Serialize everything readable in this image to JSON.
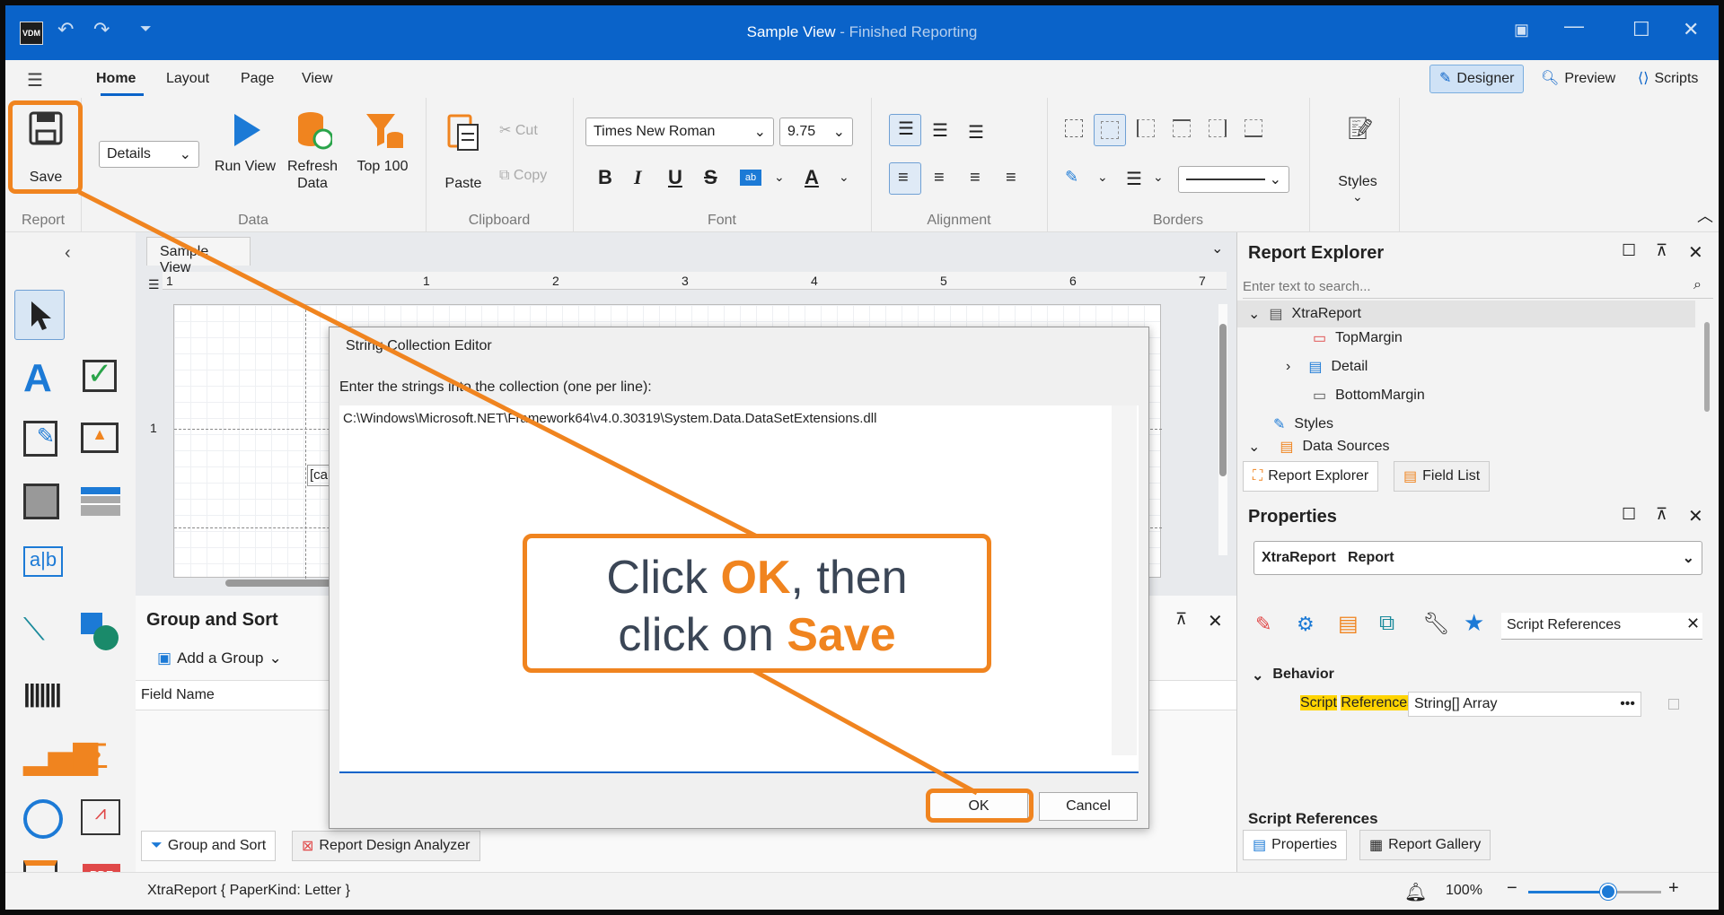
{
  "app": {
    "title": "Sample View",
    "title_suffix": "- Finished Reporting",
    "logo": "VDM"
  },
  "tabs": [
    "Home",
    "Layout",
    "Page",
    "View"
  ],
  "right_tabs": {
    "designer": "Designer",
    "preview": "Preview",
    "scripts": "Scripts"
  },
  "ribbon": {
    "save": "Save",
    "group_report": "Report",
    "details_combo": "Details",
    "run_view": "Run View",
    "refresh_data": "Refresh Data",
    "top100": "Top 100",
    "group_data": "Data",
    "paste": "Paste",
    "cut": "Cut",
    "copy": "Copy",
    "group_clipboard": "Clipboard",
    "font_name": "Times New Roman",
    "font_size": "9.75",
    "group_font": "Font",
    "group_alignment": "Alignment",
    "group_borders": "Borders",
    "styles": "Styles"
  },
  "document": {
    "tab": "Sample View",
    "ruler": [
      "1",
      "1",
      "2",
      "3",
      "4",
      "5",
      "6",
      "7"
    ],
    "side_number": "1",
    "field_partial": "[ca"
  },
  "group_sort": {
    "title": "Group and Sort",
    "add_group": "Add a Group",
    "column_field_name": "Field Name",
    "tab_group_sort": "Group and Sort",
    "tab_analyzer": "Report Design Analyzer"
  },
  "report_explorer": {
    "title": "Report Explorer",
    "search_placeholder": "Enter text to search...",
    "items": [
      "XtraReport",
      "TopMargin",
      "Detail",
      "BottomMargin",
      "Styles",
      "Data Sources"
    ],
    "tab_explorer": "Report Explorer",
    "tab_fieldlist": "Field List"
  },
  "properties": {
    "title": "Properties",
    "object_combo_name": "XtraReport",
    "object_combo_type": "Report",
    "search_value": "Script References",
    "category": "Behavior",
    "prop_name_1": "Script",
    "prop_name_2": "References",
    "prop_value": "String[] Array",
    "description_title": "Script References",
    "tab_properties": "Properties",
    "tab_gallery": "Report Gallery"
  },
  "status": {
    "text": "XtraReport { PaperKind: Letter }",
    "zoom": "100%",
    "zoom_level": 0.6
  },
  "dialog": {
    "title": "String Collection Editor",
    "instruction": "Enter the strings into the collection (one per line):",
    "content": "C:\\Windows\\Microsoft.NET\\Framework64\\v4.0.30319\\System.Data.DataSetExtensions.dll",
    "ok": "OK",
    "cancel": "Cancel"
  },
  "callout": {
    "line1_pre": "Click ",
    "line1_bold": "OK",
    "line1_post": ", then",
    "line2_pre": "click on ",
    "line2_bold": "Save"
  },
  "colors": {
    "accent": "#0a63c9",
    "highlight": "#f0841f"
  }
}
